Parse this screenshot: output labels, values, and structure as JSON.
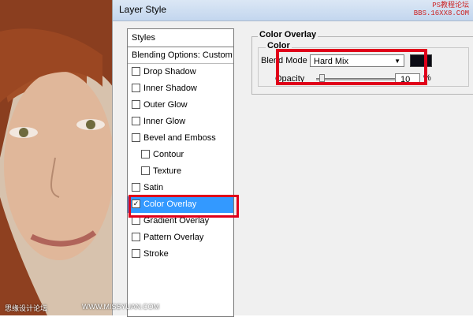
{
  "dialog": {
    "title": "Layer Style"
  },
  "watermark": {
    "top": "PS教程论坛\nBBS.16XX8.COM",
    "bottom": "思缘设计论坛",
    "bottom_url": "WWW.MISSYUAN.COM"
  },
  "styles_panel": {
    "header": "Styles",
    "blending_options": "Blending Options: Custom",
    "items": [
      {
        "label": "Drop Shadow",
        "checked": false
      },
      {
        "label": "Inner Shadow",
        "checked": false
      },
      {
        "label": "Outer Glow",
        "checked": false
      },
      {
        "label": "Inner Glow",
        "checked": false
      },
      {
        "label": "Bevel and Emboss",
        "checked": false
      },
      {
        "label": "Contour",
        "checked": false
      },
      {
        "label": "Texture",
        "checked": false
      },
      {
        "label": "Satin",
        "checked": false
      },
      {
        "label": "Color Overlay",
        "checked": true
      },
      {
        "label": "Gradient Overlay",
        "checked": false
      },
      {
        "label": "Pattern Overlay",
        "checked": false
      },
      {
        "label": "Stroke",
        "checked": false
      }
    ]
  },
  "color_overlay": {
    "group_title": "Color Overlay",
    "sub_title": "Color",
    "blend_mode_label": "Blend Mode",
    "blend_mode_value": "Hard Mix",
    "opacity_label": "Opacity",
    "opacity_value": "10",
    "opacity_unit": "%",
    "opacity_level": 0.1,
    "color": "#0b0b14"
  },
  "colors": {
    "highlight": "#e0001a",
    "selection": "#3399ff"
  }
}
